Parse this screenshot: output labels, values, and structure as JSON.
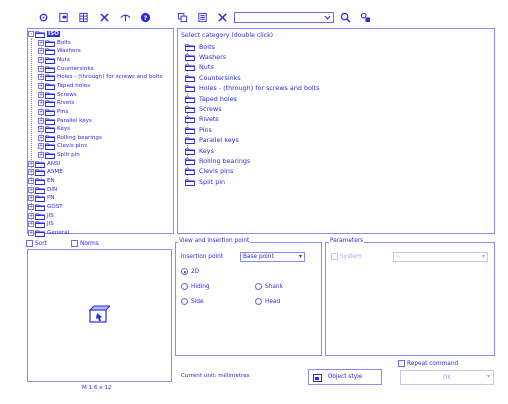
{
  "toolbar": {
    "icons": [
      "settings-icon",
      "properties-icon",
      "table-icon",
      "tools-icon",
      "visibility-icon",
      "help-icon",
      "copy-icon",
      "list-icon",
      "delete-icon",
      "search-icon",
      "find-icon"
    ],
    "search_value": ""
  },
  "tree": {
    "iso": {
      "label": "ISO",
      "children": [
        "Bolts",
        "Washers",
        "Nuts",
        "Countersinks",
        "Holes - (through) for screws and bolts",
        "Taped holes",
        "Screws",
        "Rivets",
        "Pins",
        "Parallel keys",
        "Keys",
        "Rolling bearings",
        "Clevis pins",
        "Split pin"
      ]
    },
    "standards": [
      "ANSI",
      "ASME",
      "EN",
      "DIN",
      "PN",
      "GOST",
      "JIS",
      "JIS",
      "General"
    ]
  },
  "category": {
    "title": "Select category (double click)",
    "items": [
      "Bolts",
      "Washers",
      "Nuts",
      "Countersinks",
      "Holes - (through) for screws and bolts",
      "Taped holes",
      "Screws",
      "Rivets",
      "Pins",
      "Parallel keys",
      "Keys",
      "Rolling bearings",
      "Clevis pins",
      "Split pin"
    ]
  },
  "options": {
    "sort_label": "Sort",
    "norms_label": "Norms"
  },
  "preview": {
    "caption": "M 1.6 x 12"
  },
  "view_insertion": {
    "title": "View and insertion point",
    "insertion_label": "Insertion point",
    "insertion_value": "Base point",
    "radios": {
      "r2d": "2D",
      "hiding": "Hiding",
      "shank": "Shank",
      "side": "Side",
      "head": "Head"
    }
  },
  "parameters": {
    "title": "Parameters",
    "system_label": "System",
    "system_value": "--"
  },
  "footer": {
    "current_unit": "Current unit: millimetres",
    "object_style": "Object style",
    "repeat_command": "Repeat command",
    "ok": "OK"
  },
  "colors": {
    "accent": "#2a2adf",
    "border": "#8c8cf0"
  }
}
